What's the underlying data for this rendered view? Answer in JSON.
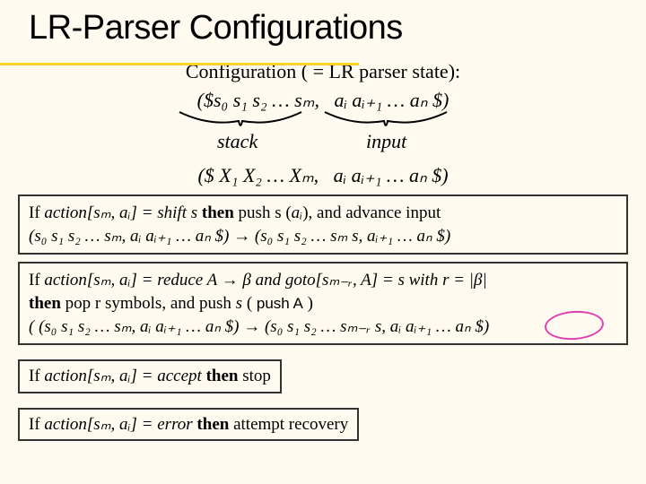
{
  "title": "LR-Parser Configurations",
  "subtitle": "Configuration ( = LR parser state):",
  "cfg_stack": "($s₀ s₁ s₂ … sₘ,",
  "cfg_input": "aᵢ aᵢ₊₁ … aₙ $)",
  "brace_left": "stack",
  "brace_right": "input",
  "cfg2_left": "($ X₁ X₂ … Xₘ,",
  "cfg2_right": "aᵢ aᵢ₊₁ … aₙ $)",
  "box1_l1a": "If ",
  "box1_l1b": "action",
  "box1_l1c": "[sₘ, aᵢ] = shift s ",
  "box1_l1d": "then",
  "box1_l1e": " push s (",
  "box1_l1f": "aᵢ",
  "box1_l1g": "), and advance input",
  "box1_l2": " (s₀ s₁ s₂ … sₘ, aᵢ aᵢ₊₁ … aₙ $) → (s₀ s₁ s₂ … sₘ s,  aᵢ₊₁ … aₙ $)",
  "box2_l1a": "If ",
  "box2_l1b": "action",
  "box2_l1c": "[sₘ, aᵢ] = reduce A → β and ",
  "box2_l1d": "goto",
  "box2_l1e": "[sₘ₋ᵣ, A] = s with r = |β|",
  "box2_l2a": "then",
  "box2_l2b": " pop r symbols, and push ",
  "box2_l2c": "s",
  "box2_l2d": " ( ",
  "box2_l2e": "push A",
  "box2_l2f": " )",
  "box2_l3": "( (s₀ s₁  s₂ … sₘ,  aᵢ  aᵢ₊₁ … aₙ $) → (s₀ s₁  s₂ … sₘ₋ᵣ s,  aᵢ aᵢ₊₁ … aₙ $)",
  "box3_a": "If ",
  "box3_b": "action",
  "box3_c": "[sₘ, aᵢ] = accept ",
  "box3_d": "then",
  "box3_e": " stop",
  "box4_a": "If ",
  "box4_b": "action",
  "box4_c": "[sₘ, aᵢ] = error ",
  "box4_d": "then",
  "box4_e": " attempt recovery"
}
